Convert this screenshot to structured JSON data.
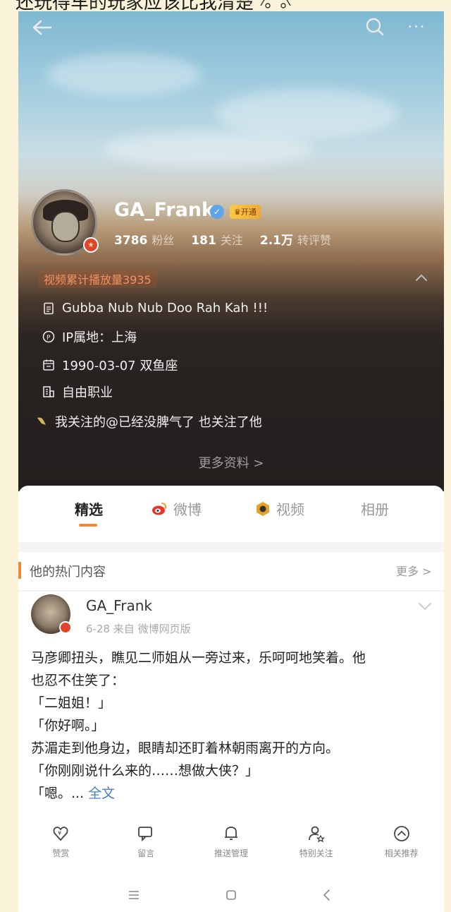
{
  "caption": {
    "text": "还玩得车的玩家应该比我清楚"
  },
  "profile": {
    "name": "GA_Frank",
    "vip_label": "开通",
    "stats": [
      {
        "num": "3786",
        "label": "粉丝"
      },
      {
        "num": "181",
        "label": "关注"
      },
      {
        "num": "2.1万",
        "label": "转评赞"
      }
    ],
    "play_count": "视频累计播放量3935",
    "info": [
      {
        "icon": "document-icon",
        "text": "Gubba Nub Nub Doo Rah Kah !!!"
      },
      {
        "icon": "ip-location-icon",
        "text": "IP属地：上海"
      },
      {
        "icon": "calendar-icon",
        "text": "1990-03-07 双鱼座"
      },
      {
        "icon": "occupation-icon",
        "text": "自由职业"
      },
      {
        "icon": "follow-note-icon",
        "text": "我关注的@已经没脾气了 也关注了他"
      }
    ],
    "more_info": "更多资料 >"
  },
  "tabs": [
    {
      "label": "精选",
      "icon": ""
    },
    {
      "label": "微博",
      "icon": "weibo-icon"
    },
    {
      "label": "视频",
      "icon": "video-icon"
    },
    {
      "label": "相册",
      "icon": ""
    }
  ],
  "hot": {
    "title": "他的热门内容",
    "more": "更多 >"
  },
  "post": {
    "author": "GA_Frank",
    "meta": "6-28  来自 微博网页版",
    "lines": [
      "马彦卿扭头，瞧见二师姐从一旁过来，乐呵呵地笑着。他",
      "也忍不住笑了：",
      "「二姐姐！」",
      "「你好啊。」",
      "苏湄走到他身边，眼睛却还盯着林朝雨离开的方向。",
      "「你刚刚说什么来的……想做大侠？」"
    ],
    "last_line": "「嗯。...",
    "full_text": "全文"
  },
  "actions": [
    {
      "icon": "reward-icon",
      "label": "赞赏"
    },
    {
      "icon": "message-icon",
      "label": "留言"
    },
    {
      "icon": "bell-icon",
      "label": "推送管理"
    },
    {
      "icon": "special-follow-icon",
      "label": "特别关注"
    },
    {
      "icon": "recommend-icon",
      "label": "相关推荐"
    }
  ],
  "colors": {
    "accent": "#f08a3a",
    "link": "#4a7fc2",
    "badge": "#e2432c",
    "dark_bg": "#231f1e"
  }
}
